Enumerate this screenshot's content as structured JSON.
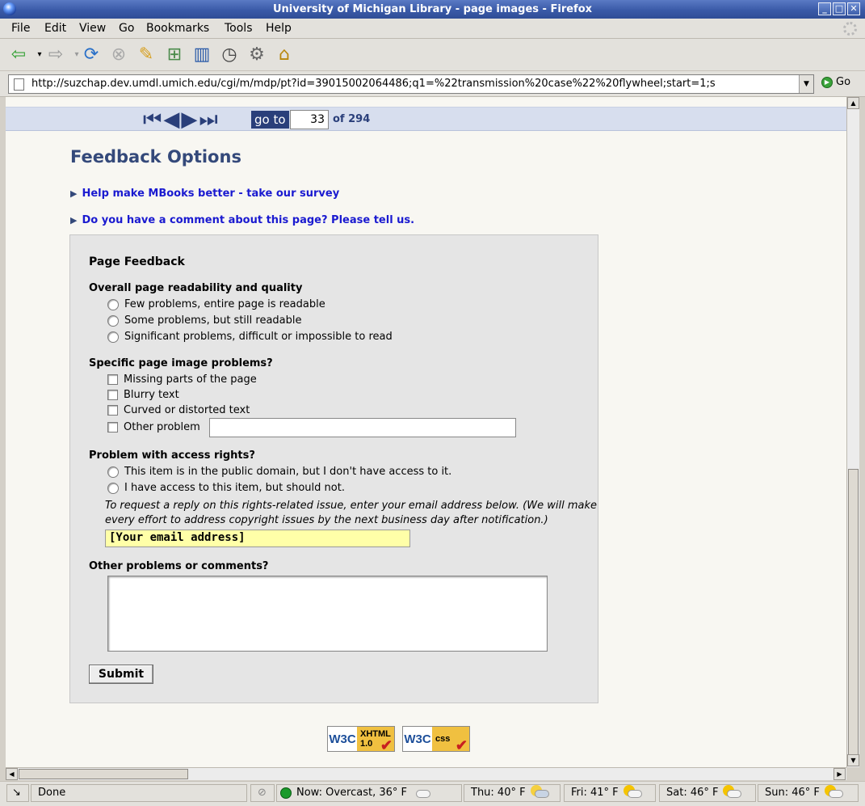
{
  "window": {
    "title": "University of Michigan Library - page images - Firefox"
  },
  "menu": {
    "items": [
      "File",
      "Edit",
      "View",
      "Go",
      "Bookmarks",
      "Tools",
      "Help"
    ]
  },
  "toolbar_icons": [
    "back-icon",
    "forward-icon",
    "reload-icon",
    "stop-icon",
    "edit-icon",
    "add-tab-icon",
    "bookmarks-icon",
    "history-icon",
    "preferences-icon",
    "home-icon"
  ],
  "address": {
    "url": "http://suzchap.dev.umdl.umich.edu/cgi/m/mdp/pt?id=39015002064486;q1=%22transmission%20case%22%20flywheel;start=1;s",
    "go_label": "Go"
  },
  "pager": {
    "goto_label": "go to",
    "current_page": "33",
    "total_label": "of 294"
  },
  "feedback": {
    "title": "Feedback Options",
    "survey_link": "Help make MBooks better - take our survey",
    "comment_link": "Do you have a comment about this page?  Please tell us.",
    "form": {
      "heading": "Page Feedback",
      "readability": {
        "label": "Overall page readability and quality",
        "options": [
          "Few problems, entire page is readable",
          "Some problems, but still readable",
          "Significant problems, difficult or impossible to read"
        ]
      },
      "image_problems": {
        "label": "Specific page image problems?",
        "options": [
          "Missing parts of the page",
          "Blurry text",
          "Curved or distorted text",
          "Other problem"
        ]
      },
      "access_rights": {
        "label": "Problem with access rights?",
        "options": [
          "This item is in the public domain, but I don't have access to it.",
          "I have access to this item, but should not."
        ],
        "note": "To request a reply on this rights-related issue, enter your email address below. (We will make every effort to address copyright issues by the next business day after notification.)",
        "email_value": "[Your email address]"
      },
      "comments": {
        "label": "Other problems or comments?"
      },
      "submit_label": "Submit"
    },
    "badges": [
      {
        "logo": "W3C",
        "line1": "XHTML",
        "line2": "1.0"
      },
      {
        "logo": "W3C",
        "line1": "css",
        "line2": ""
      }
    ]
  },
  "status": {
    "text": "Done",
    "weather": [
      "Now: Overcast, 36° F",
      "Thu: 40° F",
      "Fri: 41° F",
      "Sat: 46° F",
      "Sun: 46° F"
    ]
  },
  "colors": {
    "title_bar": "#3a5aa8",
    "link": "#1a1ad0",
    "heading": "#34497a",
    "email_field": "#ffffa8"
  }
}
